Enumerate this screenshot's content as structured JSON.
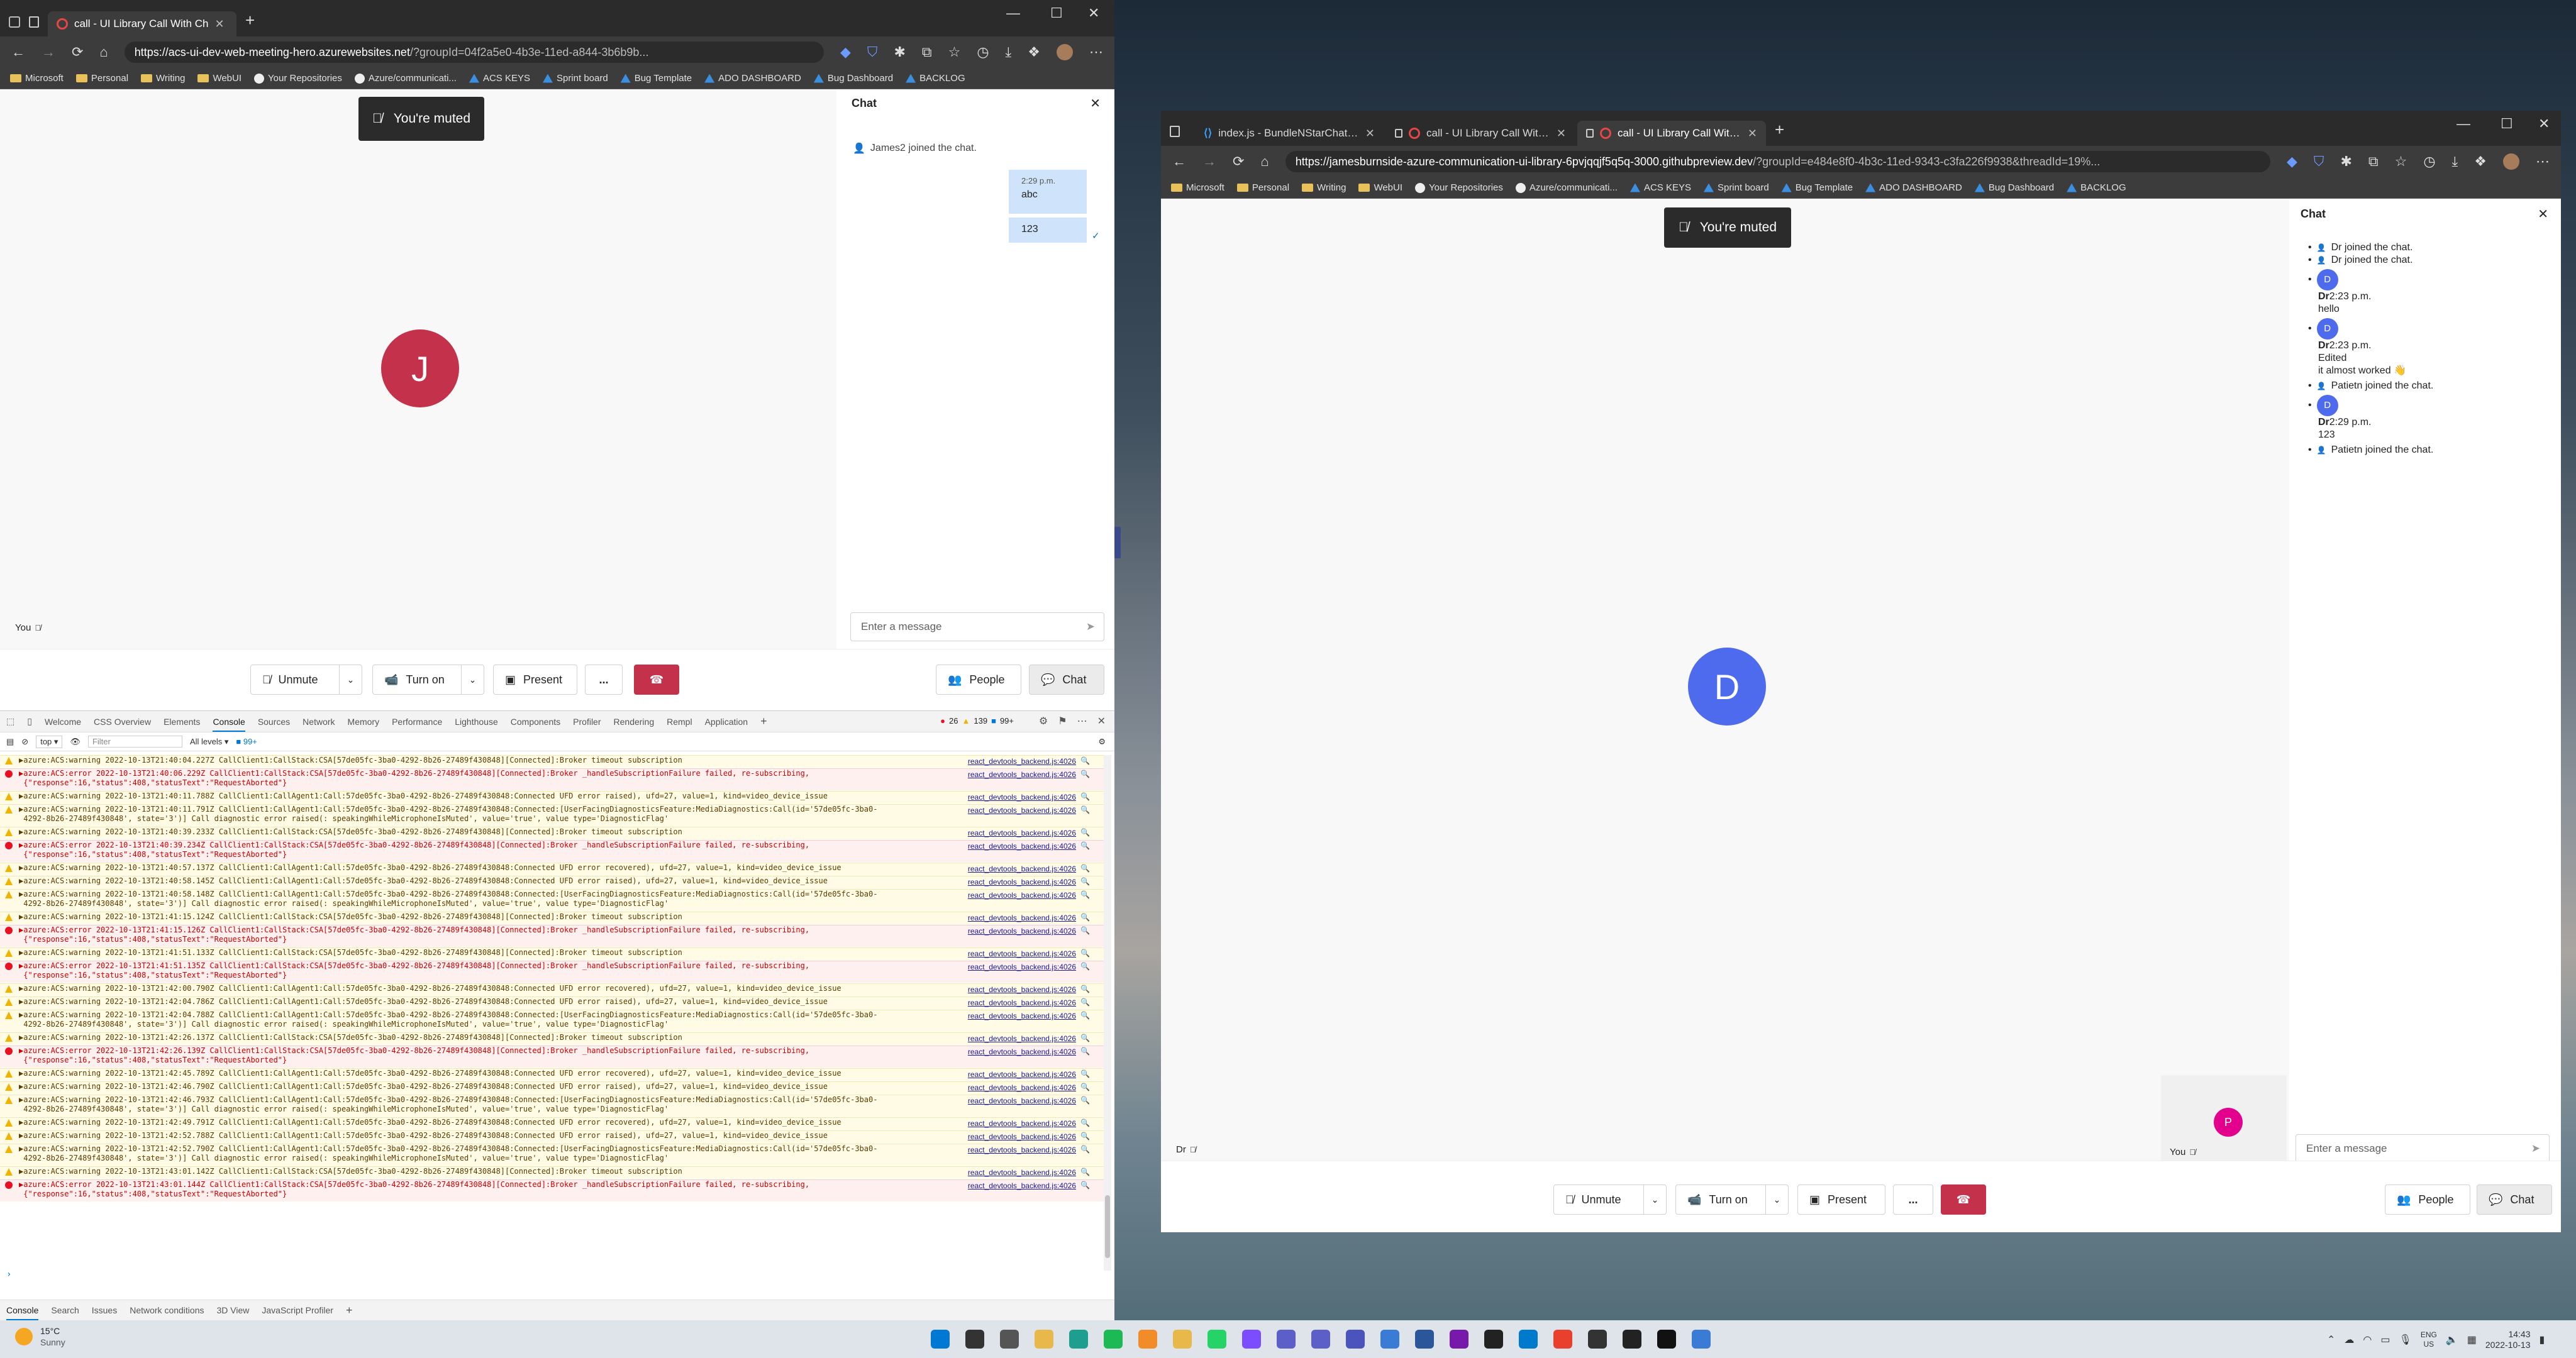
{
  "left_browser": {
    "tab_title": "call - UI Library Call With Ch",
    "url_host": "https://acs-ui-dev-web-meeting-hero.azurewebsites.net",
    "url_rest": "/?groupId=04f2a5e0-4b3e-11ed-a844-3b6b9b...",
    "bookmarks": [
      "Microsoft",
      "Personal",
      "Writing",
      "WebUI",
      "Your Repositories",
      "Azure/communicati...",
      "ACS KEYS",
      "Sprint board",
      "Bug Template",
      "ADO DASHBOARD",
      "Bug Dashboard",
      "BACKLOG"
    ]
  },
  "left_call": {
    "toast": "You're muted",
    "avatar_initial": "J",
    "self_label": "You",
    "chat_title": "Chat",
    "join_msg": "James2 joined the chat.",
    "msg_time": "2:29 p.m.",
    "msg1": "abc",
    "msg2": "123",
    "input_placeholder": "Enter a message",
    "unmute": "Unmute",
    "turn_on": "Turn on",
    "present": "Present",
    "people": "People",
    "chat": "Chat",
    "more": "..."
  },
  "devtools": {
    "tabs": [
      "Welcome",
      "CSS Overview",
      "Elements",
      "Console",
      "Sources",
      "Network",
      "Memory",
      "Performance",
      "Lighthouse",
      "Components",
      "Profiler",
      "Rendering",
      "Rempl",
      "Application"
    ],
    "err_count": "26",
    "warn_count": "139",
    "info_count": "99+",
    "context": "top",
    "filter_placeholder": "Filter",
    "levels": "All levels",
    "issues_badge": "99+",
    "source_link": "react_devtools_backend.js:4026",
    "drawer_tabs": [
      "Console",
      "Search",
      "Issues",
      "Network conditions",
      "3D View",
      "JavaScript Profiler"
    ],
    "logs": [
      {
        "t": "warn",
        "lines": [
          "▶azure:ACS:warning 2022-10-13T21:40:04.227Z CallClient1:CallStack:CSA[57de05fc-3ba0-4292-8b26-27489f430848][Connected]:Broker timeout subscription"
        ]
      },
      {
        "t": "err",
        "lines": [
          "▶azure:ACS:error 2022-10-13T21:40:06.229Z CallClient1:CallStack:CSA[57de05fc-3ba0-4292-8b26-27489f430848][Connected]:Broker _handleSubscriptionFailure failed, re-subscribing,",
          " {\"response\":16,\"status\":408,\"statusText\":\"RequestAborted\"}"
        ]
      },
      {
        "t": "warn",
        "lines": [
          "▶azure:ACS:warning 2022-10-13T21:40:11.788Z CallClient1:CallAgent1:Call:57de05fc-3ba0-4292-8b26-27489f430848:Connected UFD error raised), ufd=27, value=1, kind=video_device_issue"
        ]
      },
      {
        "t": "warn",
        "lines": [
          "▶azure:ACS:warning 2022-10-13T21:40:11.791Z CallClient1:CallAgent1:Call:57de05fc-3ba0-4292-8b26-27489f430848:Connected:[UserFacingDiagnosticsFeature:MediaDiagnostics:Call(id='57de05fc-3ba0-",
          " 4292-8b26-27489f430848', state='3')] Call diagnostic error raised(: speakingWhileMicrophoneIsMuted', value='true', value type='DiagnosticFlag'"
        ]
      },
      {
        "t": "warn",
        "lines": [
          "▶azure:ACS:warning 2022-10-13T21:40:39.233Z CallClient1:CallStack:CSA[57de05fc-3ba0-4292-8b26-27489f430848][Connected]:Broker timeout subscription"
        ]
      },
      {
        "t": "err",
        "lines": [
          "▶azure:ACS:error 2022-10-13T21:40:39.234Z CallClient1:CallStack:CSA[57de05fc-3ba0-4292-8b26-27489f430848][Connected]:Broker _handleSubscriptionFailure failed, re-subscribing,",
          " {\"response\":16,\"status\":408,\"statusText\":\"RequestAborted\"}"
        ]
      },
      {
        "t": "warn",
        "lines": [
          "▶azure:ACS:warning 2022-10-13T21:40:57.137Z CallClient1:CallAgent1:Call:57de05fc-3ba0-4292-8b26-27489f430848:Connected UFD error recovered), ufd=27, value=1, kind=video_device_issue"
        ]
      },
      {
        "t": "warn",
        "lines": [
          "▶azure:ACS:warning 2022-10-13T21:40:58.145Z CallClient1:CallAgent1:Call:57de05fc-3ba0-4292-8b26-27489f430848:Connected UFD error raised), ufd=27, value=1, kind=video_device_issue"
        ]
      },
      {
        "t": "warn",
        "lines": [
          "▶azure:ACS:warning 2022-10-13T21:40:58.148Z CallClient1:CallAgent1:Call:57de05fc-3ba0-4292-8b26-27489f430848:Connected:[UserFacingDiagnosticsFeature:MediaDiagnostics:Call(id='57de05fc-3ba0-",
          " 4292-8b26-27489f430848', state='3')] Call diagnostic error raised(: speakingWhileMicrophoneIsMuted', value='true', value type='DiagnosticFlag'"
        ]
      },
      {
        "t": "warn",
        "lines": [
          "▶azure:ACS:warning 2022-10-13T21:41:15.124Z CallClient1:CallStack:CSA[57de05fc-3ba0-4292-8b26-27489f430848][Connected]:Broker timeout subscription"
        ]
      },
      {
        "t": "err",
        "lines": [
          "▶azure:ACS:error 2022-10-13T21:41:15.126Z CallClient1:CallStack:CSA[57de05fc-3ba0-4292-8b26-27489f430848][Connected]:Broker _handleSubscriptionFailure failed, re-subscribing,",
          " {\"response\":16,\"status\":408,\"statusText\":\"RequestAborted\"}"
        ]
      },
      {
        "t": "warn",
        "lines": [
          "▶azure:ACS:warning 2022-10-13T21:41:51.133Z CallClient1:CallStack:CSA[57de05fc-3ba0-4292-8b26-27489f430848][Connected]:Broker timeout subscription"
        ]
      },
      {
        "t": "err",
        "lines": [
          "▶azure:ACS:error 2022-10-13T21:41:51.135Z CallClient1:CallStack:CSA[57de05fc-3ba0-4292-8b26-27489f430848][Connected]:Broker _handleSubscriptionFailure failed, re-subscribing,",
          " {\"response\":16,\"status\":408,\"statusText\":\"RequestAborted\"}"
        ]
      },
      {
        "t": "warn",
        "lines": [
          "▶azure:ACS:warning 2022-10-13T21:42:00.790Z CallClient1:CallAgent1:Call:57de05fc-3ba0-4292-8b26-27489f430848:Connected UFD error recovered), ufd=27, value=1, kind=video_device_issue"
        ]
      },
      {
        "t": "warn",
        "lines": [
          "▶azure:ACS:warning 2022-10-13T21:42:04.786Z CallClient1:CallAgent1:Call:57de05fc-3ba0-4292-8b26-27489f430848:Connected UFD error raised), ufd=27, value=1, kind=video_device_issue"
        ]
      },
      {
        "t": "warn",
        "lines": [
          "▶azure:ACS:warning 2022-10-13T21:42:04.788Z CallClient1:CallAgent1:Call:57de05fc-3ba0-4292-8b26-27489f430848:Connected:[UserFacingDiagnosticsFeature:MediaDiagnostics:Call(id='57de05fc-3ba0-",
          " 4292-8b26-27489f430848', state='3')] Call diagnostic error raised(: speakingWhileMicrophoneIsMuted', value='true', value type='DiagnosticFlag'"
        ]
      },
      {
        "t": "warn",
        "lines": [
          "▶azure:ACS:warning 2022-10-13T21:42:26.137Z CallClient1:CallStack:CSA[57de05fc-3ba0-4292-8b26-27489f430848][Connected]:Broker timeout subscription"
        ]
      },
      {
        "t": "err",
        "lines": [
          "▶azure:ACS:error 2022-10-13T21:42:26.139Z CallClient1:CallStack:CSA[57de05fc-3ba0-4292-8b26-27489f430848][Connected]:Broker _handleSubscriptionFailure failed, re-subscribing,",
          " {\"response\":16,\"status\":408,\"statusText\":\"RequestAborted\"}"
        ]
      },
      {
        "t": "warn",
        "lines": [
          "▶azure:ACS:warning 2022-10-13T21:42:45.789Z CallClient1:CallAgent1:Call:57de05fc-3ba0-4292-8b26-27489f430848:Connected UFD error recovered), ufd=27, value=1, kind=video_device_issue"
        ]
      },
      {
        "t": "warn",
        "lines": [
          "▶azure:ACS:warning 2022-10-13T21:42:46.790Z CallClient1:CallAgent1:Call:57de05fc-3ba0-4292-8b26-27489f430848:Connected UFD error raised), ufd=27, value=1, kind=video_device_issue"
        ]
      },
      {
        "t": "warn",
        "lines": [
          "▶azure:ACS:warning 2022-10-13T21:42:46.793Z CallClient1:CallAgent1:Call:57de05fc-3ba0-4292-8b26-27489f430848:Connected:[UserFacingDiagnosticsFeature:MediaDiagnostics:Call(id='57de05fc-3ba0-",
          " 4292-8b26-27489f430848', state='3')] Call diagnostic error raised(: speakingWhileMicrophoneIsMuted', value='true', value type='DiagnosticFlag'"
        ]
      },
      {
        "t": "warn",
        "lines": [
          "▶azure:ACS:warning 2022-10-13T21:42:49.791Z CallClient1:CallAgent1:Call:57de05fc-3ba0-4292-8b26-27489f430848:Connected UFD error recovered), ufd=27, value=1, kind=video_device_issue"
        ]
      },
      {
        "t": "warn",
        "lines": [
          "▶azure:ACS:warning 2022-10-13T21:42:52.788Z CallClient1:CallAgent1:Call:57de05fc-3ba0-4292-8b26-27489f430848:Connected UFD error raised), ufd=27, value=1, kind=video_device_issue"
        ]
      },
      {
        "t": "warn",
        "lines": [
          "▶azure:ACS:warning 2022-10-13T21:42:52.790Z CallClient1:CallAgent1:Call:57de05fc-3ba0-4292-8b26-27489f430848:Connected:[UserFacingDiagnosticsFeature:MediaDiagnostics:Call(id='57de05fc-3ba0-",
          " 4292-8b26-27489f430848', state='3')] Call diagnostic error raised(: speakingWhileMicrophoneIsMuted', value='true', value type='DiagnosticFlag'"
        ]
      },
      {
        "t": "warn",
        "lines": [
          "▶azure:ACS:warning 2022-10-13T21:43:01.142Z CallClient1:CallStack:CSA[57de05fc-3ba0-4292-8b26-27489f430848][Connected]:Broker timeout subscription"
        ]
      },
      {
        "t": "err",
        "lines": [
          "▶azure:ACS:error 2022-10-13T21:43:01.144Z CallClient1:CallStack:CSA[57de05fc-3ba0-4292-8b26-27489f430848][Connected]:Broker _handleSubscriptionFailure failed, re-subscribing,",
          " {\"response\":16,\"status\":408,\"statusText\":\"RequestAborted\"}"
        ]
      }
    ]
  },
  "right_browser": {
    "tabs": [
      "index.js - BundleNStarChatComp",
      "call - UI Library Call With Ch",
      "call - UI Library Call With Ch"
    ],
    "url_host": "https://jamesburnside-azure-communication-ui-library-6pvjqqjf5q5q-3000.githubpreview.dev",
    "url_rest": "/?groupId=e484e8f0-4b3c-11ed-9343-c3fa226f9938&threadId=19%...",
    "bookmarks": [
      "Microsoft",
      "Personal",
      "Writing",
      "WebUI",
      "Your Repositories",
      "Azure/communicati...",
      "ACS KEYS",
      "Sprint board",
      "Bug Template",
      "ADO DASHBOARD",
      "Bug Dashboard",
      "BACKLOG"
    ]
  },
  "right_call": {
    "toast": "You're muted",
    "avatar_initial": "D",
    "remote_label": "Dr",
    "pip_initial": "P",
    "self_label": "You",
    "chat_title": "Chat",
    "messages": [
      {
        "kind": "sys",
        "text": "Dr joined the chat."
      },
      {
        "kind": "sys",
        "text": "Dr joined the chat."
      },
      {
        "kind": "msg",
        "sender": "Dr",
        "time": "2:23 p.m.",
        "text": "hello",
        "edited": ""
      },
      {
        "kind": "msg",
        "sender": "Dr",
        "time": "2:23 p.m.",
        "text": "it almost worked 👋",
        "edited": "Edited"
      },
      {
        "kind": "sys",
        "text": "Patietn joined the chat."
      },
      {
        "kind": "msg",
        "sender": "Dr",
        "time": "2:29 p.m.",
        "text": "123",
        "edited": ""
      },
      {
        "kind": "sys",
        "text": "Patietn joined the chat."
      }
    ],
    "input_placeholder": "Enter a message",
    "unmute": "Unmute",
    "turn_on": "Turn on",
    "present": "Present",
    "people": "People",
    "chat": "Chat",
    "more": "..."
  },
  "taskbar": {
    "temp": "15°C",
    "weather": "Sunny",
    "lang1": "ENG",
    "lang2": "US",
    "time": "14:43",
    "date": "2022-10-13"
  },
  "colors": {
    "avatar_red": "#c4314b",
    "avatar_blue": "#4f6bed",
    "pip_pink": "#e3008c",
    "hangup": "#c4314b",
    "bubble": "#cfe4fa"
  }
}
